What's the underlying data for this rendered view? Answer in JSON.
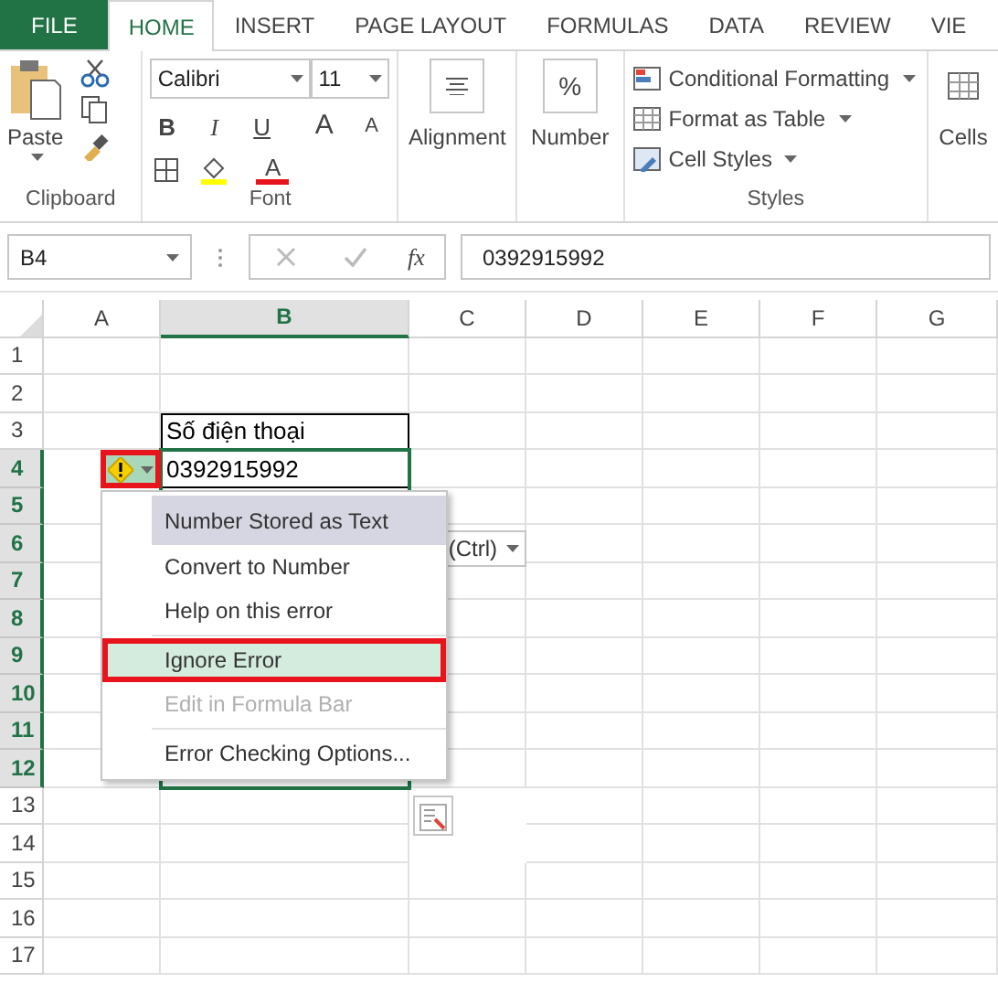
{
  "tabs": [
    {
      "label": "FILE",
      "kind": "file",
      "selected": false
    },
    {
      "label": "HOME",
      "kind": "tab",
      "selected": true
    },
    {
      "label": "INSERT",
      "kind": "tab",
      "selected": false
    },
    {
      "label": "PAGE LAYOUT",
      "kind": "tab",
      "selected": false
    },
    {
      "label": "FORMULAS",
      "kind": "tab",
      "selected": false
    },
    {
      "label": "DATA",
      "kind": "tab",
      "selected": false
    },
    {
      "label": "REVIEW",
      "kind": "tab",
      "selected": false
    },
    {
      "label": "VIE",
      "kind": "tab",
      "selected": false
    }
  ],
  "ribbon": {
    "clipboard": {
      "paste": "Paste",
      "label": "Clipboard"
    },
    "font": {
      "name": "Calibri",
      "size": "11",
      "bold": "B",
      "italic": "I",
      "underline": "U",
      "grow": "A",
      "shrink": "A",
      "color_letter": "A",
      "label": "Font"
    },
    "alignment": {
      "label": "Alignment"
    },
    "number": {
      "symbol": "%",
      "label": "Number"
    },
    "styles": {
      "items": [
        "Conditional Formatting",
        "Format as Table",
        "Cell Styles"
      ],
      "label": "Styles"
    },
    "cells": {
      "label": "Cells"
    }
  },
  "formula_bar": {
    "name_box": "B4",
    "function_symbol": "fx",
    "value": "0392915992"
  },
  "sheet": {
    "columns": [
      {
        "label": "A",
        "selected": false
      },
      {
        "label": "B",
        "selected": true
      },
      {
        "label": "C",
        "selected": false
      },
      {
        "label": "D",
        "selected": false
      },
      {
        "label": "E",
        "selected": false
      },
      {
        "label": "F",
        "selected": false
      },
      {
        "label": "G",
        "selected": false
      }
    ],
    "rows": [
      {
        "label": "1",
        "selected": false
      },
      {
        "label": "2",
        "selected": false
      },
      {
        "label": "3",
        "selected": false,
        "cells": [
          null,
          {
            "text": "Số điện thoại",
            "bordered": true
          }
        ]
      },
      {
        "label": "4",
        "selected": true,
        "cells": [
          null,
          {
            "text": "0392915992",
            "bordered": true
          }
        ]
      },
      {
        "label": "5",
        "selected": true
      },
      {
        "label": "6",
        "selected": true
      },
      {
        "label": "7",
        "selected": true
      },
      {
        "label": "8",
        "selected": true
      },
      {
        "label": "9",
        "selected": true
      },
      {
        "label": "10",
        "selected": true
      },
      {
        "label": "11",
        "selected": true
      },
      {
        "label": "12",
        "selected": true
      },
      {
        "label": "13",
        "selected": false
      },
      {
        "label": "14",
        "selected": false
      },
      {
        "label": "15",
        "selected": false
      },
      {
        "label": "16",
        "selected": false
      },
      {
        "label": "17",
        "selected": false
      }
    ]
  },
  "error_button": {
    "annotated": true
  },
  "paste_options": {
    "text": "(Ctrl)"
  },
  "menu": [
    {
      "label": "Number Stored as Text",
      "kind": "header",
      "disabled": false,
      "selected": false,
      "annotated": false
    },
    {
      "label": "Convert to Number",
      "kind": "item",
      "disabled": false,
      "selected": false,
      "annotated": false
    },
    {
      "label": "Help on this error",
      "kind": "item",
      "disabled": false,
      "selected": false,
      "annotated": false
    },
    {
      "label": "Ignore Error",
      "kind": "item",
      "disabled": false,
      "selected": true,
      "annotated": true
    },
    {
      "label": "Edit in Formula Bar",
      "kind": "item",
      "disabled": true,
      "selected": false,
      "annotated": false
    },
    {
      "label": "Error Checking Options...",
      "kind": "item",
      "disabled": false,
      "selected": false,
      "annotated": false
    }
  ]
}
